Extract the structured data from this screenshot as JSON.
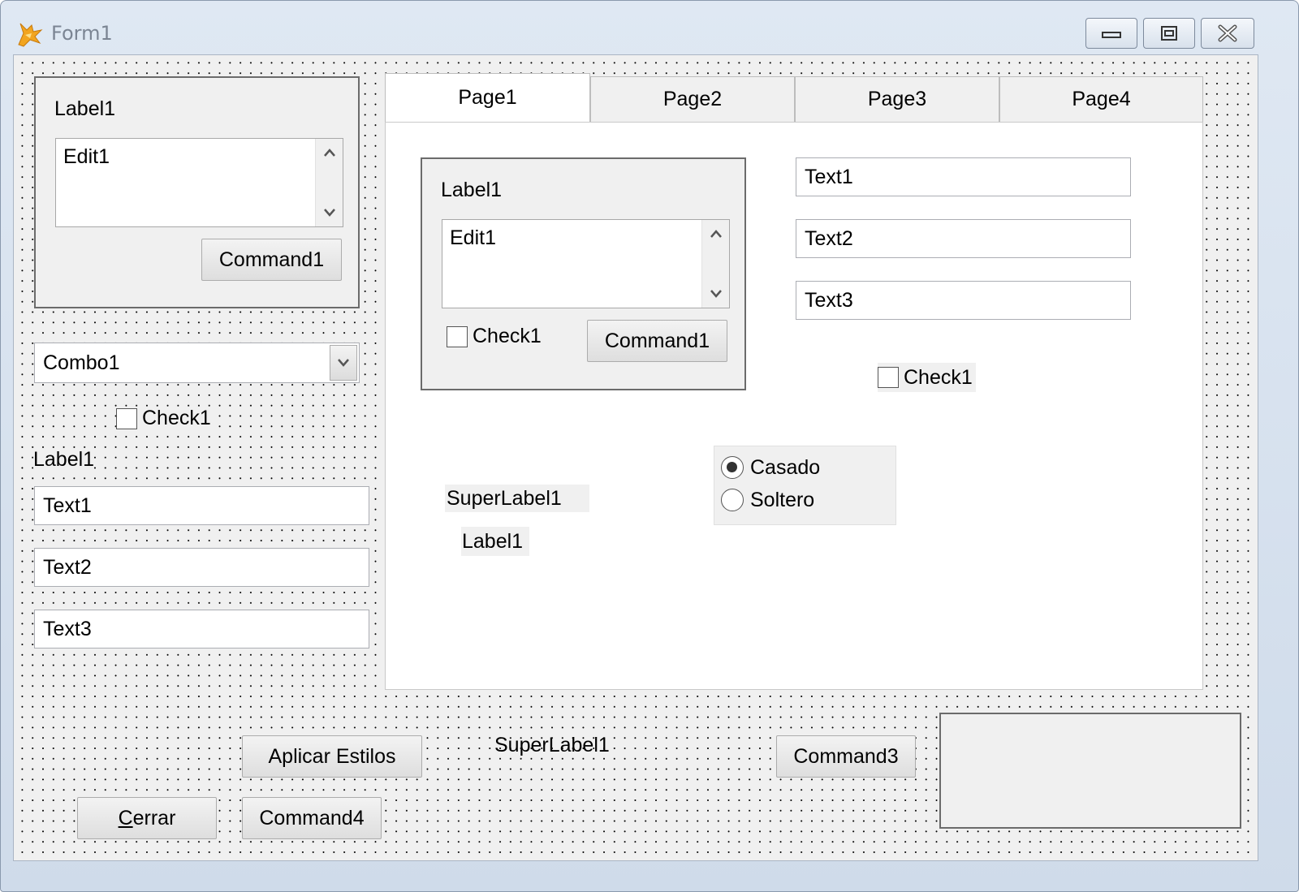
{
  "window": {
    "title": "Form1"
  },
  "left_frame": {
    "label": "Label1",
    "edit": "Edit1",
    "button": "Command1"
  },
  "combo": {
    "value": "Combo1"
  },
  "left_check": "Check1",
  "left_label": "Label1",
  "left_texts": [
    "Text1",
    "Text2",
    "Text3"
  ],
  "tabs": [
    "Page1",
    "Page2",
    "Page3",
    "Page4"
  ],
  "page1": {
    "frame": {
      "label": "Label1",
      "edit": "Edit1",
      "check": "Check1",
      "button": "Command1"
    },
    "texts": [
      "Text1",
      "Text2",
      "Text3"
    ],
    "check": "Check1",
    "superlabel": "SuperLabel1",
    "label": "Label1",
    "options": [
      "Casado",
      "Soltero"
    ]
  },
  "bottom": {
    "apply_styles": "Aplicar Estilos",
    "superlabel": "SuperLabel1",
    "command3": "Command3",
    "close_accel": "C",
    "close_rest": "errar",
    "command4": "Command4"
  }
}
